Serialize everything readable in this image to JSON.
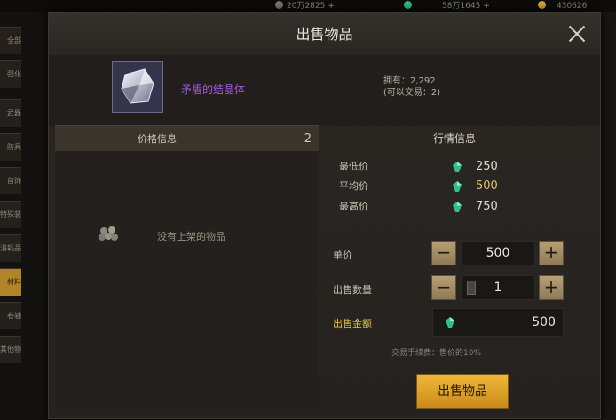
{
  "topbar": {
    "res1": "20万2825",
    "res2": "58万1645",
    "res3": "430626"
  },
  "sidebar": {
    "items": [
      {
        "label": "全部"
      },
      {
        "label": "强化"
      },
      {
        "label": "武器"
      },
      {
        "label": "防具"
      },
      {
        "label": "首饰"
      },
      {
        "label": "特殊装备"
      },
      {
        "label": "消耗品"
      },
      {
        "label": "材料",
        "active": true
      },
      {
        "label": "卷轴"
      },
      {
        "label": "其他物品"
      }
    ]
  },
  "dialog": {
    "title": "出售物品",
    "item": {
      "name": "矛盾的结晶体",
      "owned": "拥有：2,292",
      "tradable": "(可以交易：2)",
      "icon": "crystal-icon"
    },
    "price_info": {
      "header": "价格信息",
      "count": "2",
      "empty_text": "没有上架的物品"
    },
    "market": {
      "title": "行情信息",
      "min_label": "最低价",
      "min_value": "250",
      "avg_label": "平均价",
      "avg_value": "500",
      "max_label": "最高价",
      "max_value": "750"
    },
    "unit_price": {
      "label": "单价",
      "value": "500"
    },
    "quantity": {
      "label": "出售数量",
      "value": "1"
    },
    "total": {
      "label": "出售金额",
      "value": "500"
    },
    "fee_note": "交易手续费：售价的10%",
    "sell_button": "出售物品",
    "colors": {
      "accent": "#e8b030",
      "item_name": "#a35de0",
      "gem": "#2fbf88"
    }
  }
}
